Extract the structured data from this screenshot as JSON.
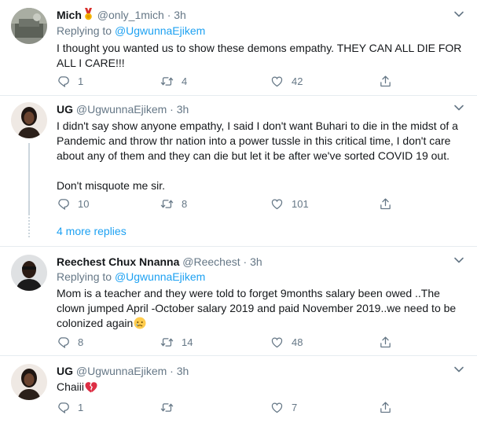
{
  "tweets": [
    {
      "name": "Mich",
      "badge": "medal",
      "handle": "@only_1mich",
      "time": "3h",
      "replying_prefix": "Replying to",
      "replying_to": "@UgwunnaEjikem",
      "text": "I thought you wanted us to show these demons empathy. THEY CAN ALL DIE FOR ALL I CARE!!!",
      "replies": "1",
      "retweets": "4",
      "likes": "42"
    },
    {
      "name": "UG",
      "handle": "@UgwunnaEjikem",
      "time": "3h",
      "text_p1": "I didn't say show anyone empathy, I said I don't want Buhari to die in the midst of a Pandemic and throw thr nation into a power tussle in this critical time, I don't care about any of them and they can die but let it be after we've sorted COVID 19 out.",
      "text_p2": "Don't misquote me sir.",
      "replies": "10",
      "retweets": "8",
      "likes": "101"
    },
    {
      "name": "Reechest Chux Nnanna",
      "handle": "@Reechest",
      "time": "3h",
      "replying_prefix": "Replying to",
      "replying_to": "@UgwunnaEjikem",
      "text": "Mom is a teacher and they were told to forget 9months salary been owed ..The clown jumped April -October salary 2019 and paid November 2019..we need to be colonized again",
      "text_emoji": "crying-face",
      "replies": "8",
      "retweets": "14",
      "likes": "48"
    },
    {
      "name": "UG",
      "handle": "@UgwunnaEjikem",
      "time": "3h",
      "text": "Chaiii",
      "text_emoji": "broken-heart",
      "replies": "1",
      "retweets": "",
      "likes": "7"
    }
  ],
  "more_replies": "4 more replies",
  "separator_dot": "·",
  "colors": {
    "link": "#1da1f2",
    "muted": "#657786",
    "text": "#14171a",
    "line": "#ccd6dd",
    "divider": "#e6ecf0"
  },
  "icons": [
    "reply-icon",
    "retweet-icon",
    "like-icon",
    "share-icon",
    "caret-down-icon",
    "medal-icon",
    "crying-face-emoji",
    "broken-heart-emoji"
  ]
}
